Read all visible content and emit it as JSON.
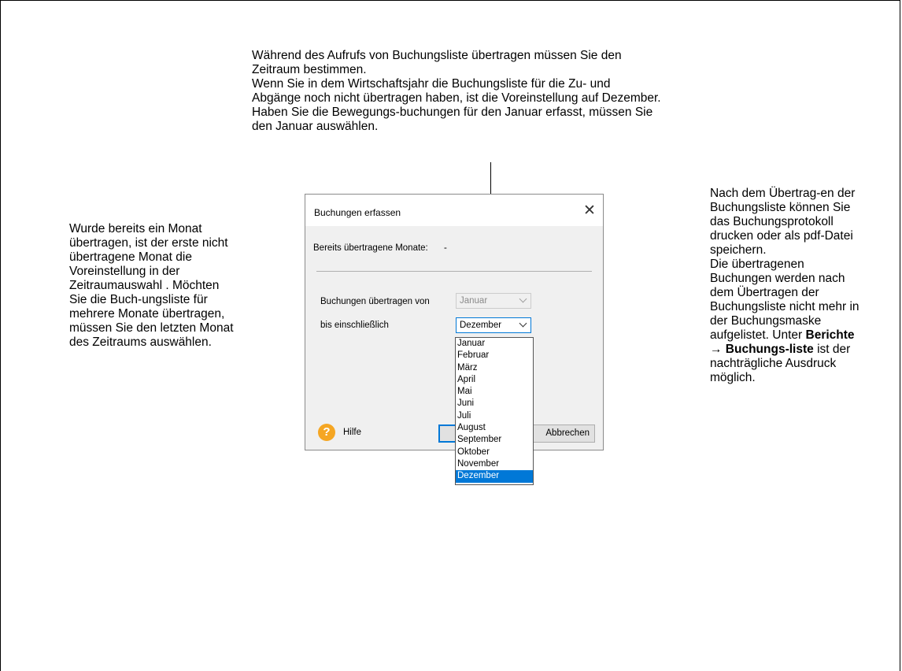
{
  "annotations": {
    "top": "Während des Aufrufs von Buchungsliste übertragen müssen Sie den Zeitraum bestimmen.\nWenn Sie in dem Wirtschaftsjahr die Buchungsliste für die Zu- und Abgänge noch nicht übertragen haben, ist die Voreinstellung auf Dezember. Haben Sie die Bewegungs-buchungen für den Januar erfasst, müssen Sie den Januar auswählen.",
    "left": "Wurde bereits ein Monat übertragen, ist der erste nicht übertragene Monat die Voreinstellung in der Zeitraumauswahl . Möchten Sie die Buch-ungsliste für mehrere Monate übertragen, müssen Sie den letzten Monat des Zeitraums auswählen.",
    "right_part1": "Nach dem Übertrag-en der Buchungsliste können Sie das Buchungsprotokoll drucken oder als pdf-Datei speichern.\nDie übertragenen Buchungen werden nach dem Übertragen der Buchungsliste nicht mehr in der Buchungsmaske aufgelistet. Unter",
    "right_bold": "Berichte → Buchungs-liste",
    "right_part2": " ist der nachträgliche Ausdruck möglich."
  },
  "dialog": {
    "title": "Buchungen erfassen",
    "close_symbol": "✕",
    "already_transferred_label": "Bereits übertragene Monate:",
    "already_transferred_value": "-",
    "from_label": "Buchungen übertragen von",
    "from_value": "Januar",
    "to_label": "bis einschließlich",
    "to_value": "Dezember",
    "help_symbol": "?",
    "help_label": "Hilfe",
    "cancel_label": "Abbrechen",
    "months": [
      "Januar",
      "Februar",
      "März",
      "April",
      "Mai",
      "Juni",
      "Juli",
      "August",
      "September",
      "Oktober",
      "November",
      "Dezember"
    ],
    "selected_month": "Dezember"
  }
}
